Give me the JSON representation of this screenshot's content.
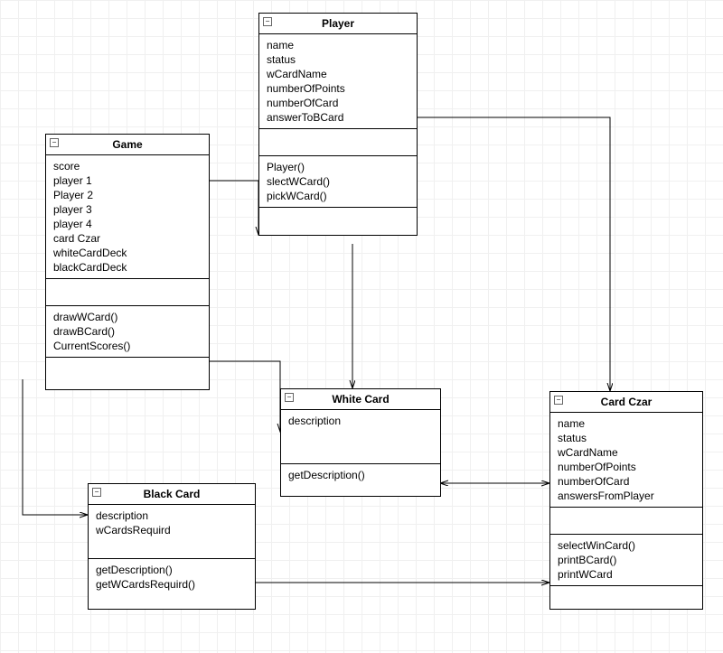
{
  "classes": {
    "game": {
      "title": "Game",
      "attrs": [
        "score",
        "player 1",
        "Player 2",
        "player 3",
        "player 4",
        "card Czar",
        "whiteCardDeck",
        "blackCardDeck"
      ],
      "ops": [
        "drawWCard()",
        "drawBCard()",
        "CurrentScores()"
      ]
    },
    "player": {
      "title": "Player",
      "attrs": [
        "name",
        "status",
        "wCardName",
        "numberOfPoints",
        "numberOfCard",
        "answerToBCard"
      ],
      "ops": [
        "Player()",
        "slectWCard()",
        "pickWCard()"
      ]
    },
    "whiteCard": {
      "title": "White Card",
      "attrs": [
        "description"
      ],
      "ops": [
        "getDescription()"
      ]
    },
    "blackCard": {
      "title": "Black Card",
      "attrs": [
        "description",
        "wCardsRequird"
      ],
      "ops": [
        "getDescription()",
        "getWCardsRequird()"
      ]
    },
    "cardCzar": {
      "title": "Card Czar",
      "attrs": [
        "name",
        "status",
        "wCardName",
        "numberOfPoints",
        "numberOfCard",
        "answersFromPlayer"
      ],
      "ops": [
        "selectWinCard()",
        "printBCard()",
        "printWCard"
      ]
    }
  }
}
